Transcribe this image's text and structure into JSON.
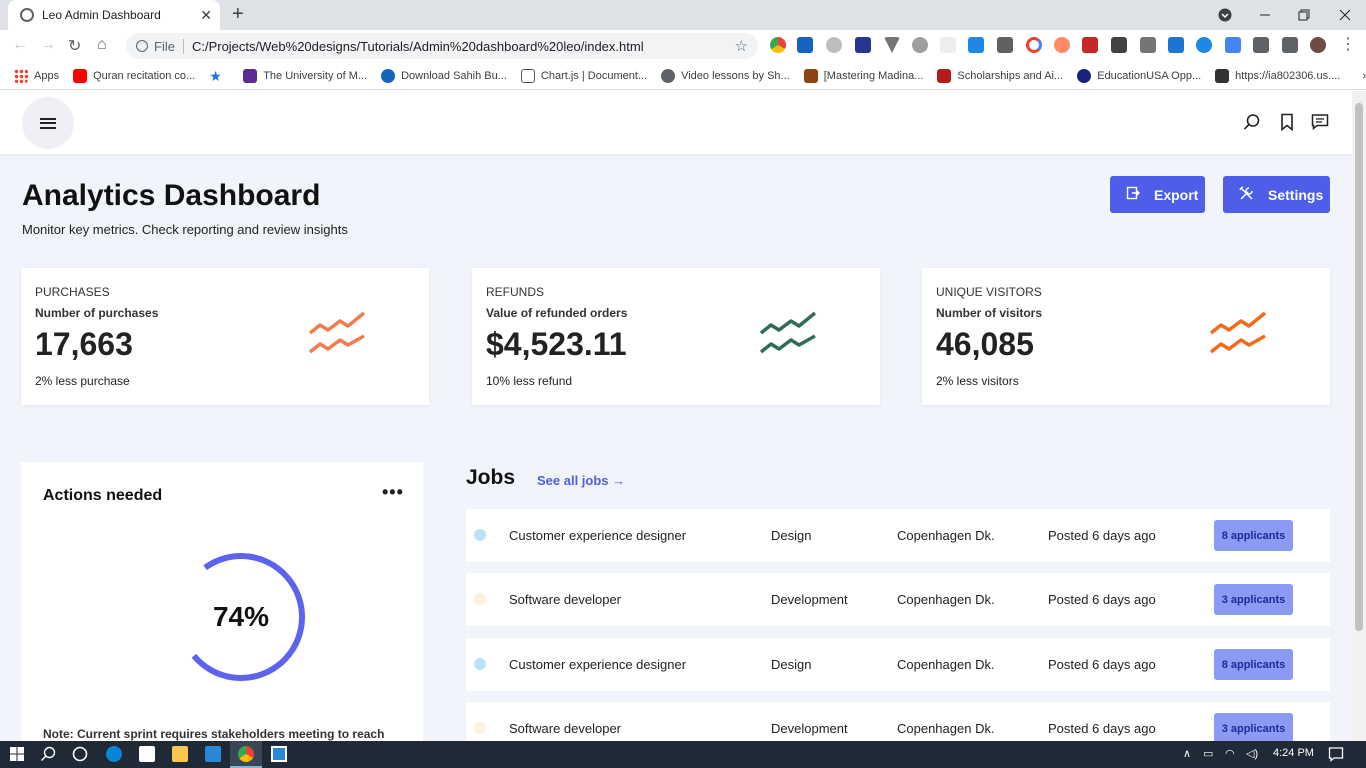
{
  "browser": {
    "tab_title": "Leo Admin Dashboard",
    "tab_close": "✕",
    "new_tab": "+",
    "url_scheme": "File",
    "url": "C:/Projects/Web%20designs/Tutorials/Admin%20dashboard%20leo/index.html",
    "bookmarks": [
      {
        "label": "Apps",
        "color": "#ea4335"
      },
      {
        "label": "Quran recitation co...",
        "color": "#ff0000"
      },
      {
        "label": "",
        "color": "#1a73e8"
      },
      {
        "label": "The University of M...",
        "color": "#5c2d91"
      },
      {
        "label": "Download Sahih Bu...",
        "color": "#1565c0"
      },
      {
        "label": "Chart.js | Document...",
        "color": "#555555"
      },
      {
        "label": "Video lessons by Sh...",
        "color": "#5f6368"
      },
      {
        "label": "[Mastering Madina...",
        "color": "#8b4513"
      },
      {
        "label": "Scholarships and Ai...",
        "color": "#b71c1c"
      },
      {
        "label": "EducationUSA Opp...",
        "color": "#1a237e"
      },
      {
        "label": "https://ia802306.us....",
        "color": "#333333"
      }
    ],
    "more_bookmarks": "»"
  },
  "header": {
    "search_icon": "search-icon",
    "bookmark_icon": "bookmark-icon",
    "chat_icon": "chat-icon"
  },
  "page": {
    "title": "Analytics Dashboard",
    "subtitle": "Monitor key metrics. Check reporting and review insights",
    "export_label": "Export",
    "settings_label": "Settings"
  },
  "cards": [
    {
      "label": "PURCHASES",
      "desc": "Number of purchases",
      "value": "17,663",
      "note": "2% less purchase",
      "color": "#f27b4f"
    },
    {
      "label": "REFUNDS",
      "desc": "Value of refunded orders",
      "value": "$4,523.11",
      "note": "10% less refund",
      "color": "#2e6b5a"
    },
    {
      "label": "UNIQUE VISITORS",
      "desc": "Number of visitors",
      "value": "46,085",
      "note": "2% less visitors",
      "color": "#f26a1b"
    }
  ],
  "actions": {
    "title": "Actions needed",
    "menu": "•••",
    "percent": "74%",
    "progress": 0.74,
    "note": "Note: Current sprint requires stakeholders meeting to reach"
  },
  "jobs": {
    "title": "Jobs",
    "see_all": "See all jobs →",
    "rows": [
      {
        "title": "Customer experience designer",
        "dept": "Design",
        "location": "Copenhagen Dk.",
        "posted": "Posted 6 days ago",
        "applicants": "8 applicants",
        "dot": "#b9e4f7"
      },
      {
        "title": "Software developer",
        "dept": "Development",
        "location": "Copenhagen Dk.",
        "posted": "Posted 6 days ago",
        "applicants": "3 applicants",
        "dot": "#fdf0dc"
      },
      {
        "title": "Customer experience designer",
        "dept": "Design",
        "location": "Copenhagen Dk.",
        "posted": "Posted 6 days ago",
        "applicants": "8 applicants",
        "dot": "#b9e4f7"
      },
      {
        "title": "Software developer",
        "dept": "Development",
        "location": "Copenhagen Dk.",
        "posted": "Posted 6 days ago",
        "applicants": "3 applicants",
        "dot": "#fdf0dc"
      }
    ]
  },
  "taskbar": {
    "time": "4:24 PM"
  }
}
